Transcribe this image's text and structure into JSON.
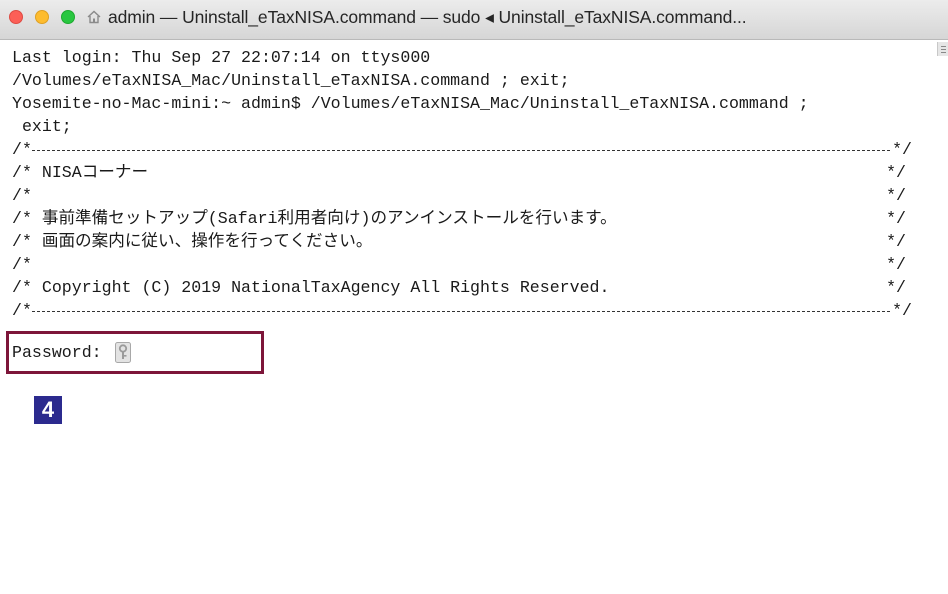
{
  "window": {
    "title": "admin — Uninstall_eTaxNISA.command — sudo ◂ Uninstall_eTaxNISA.command..."
  },
  "terminal": {
    "lines": [
      "Last login: Thu Sep 27 22:07:14 on ttys000",
      "/Volumes/eTaxNISA_Mac/Uninstall_eTaxNISA.command ; exit;",
      "Yosemite-no-Mac-mini:~ admin$ /Volumes/eTaxNISA_Mac/Uninstall_eTaxNISA.command ;",
      " exit;"
    ],
    "banner": {
      "rule_start": "/*",
      "rule_end": "*/",
      "close": "*/",
      "rows": [
        "/* NISAコーナー",
        "/*",
        "/* 事前準備セットアップ(Safari利用者向け)のアンインストールを行います。",
        "/* 画面の案内に従い、操作を行ってください。",
        "/*",
        "/* Copyright (C) 2019 NationalTaxAgency All Rights Reserved."
      ]
    },
    "password_prompt": "Password:"
  },
  "annotation": {
    "step_number": "4",
    "highlight_color": "#7d1539",
    "badge_color": "#2b2a8e"
  },
  "icons": {
    "home": "home-icon",
    "cursor": "key-icon"
  }
}
